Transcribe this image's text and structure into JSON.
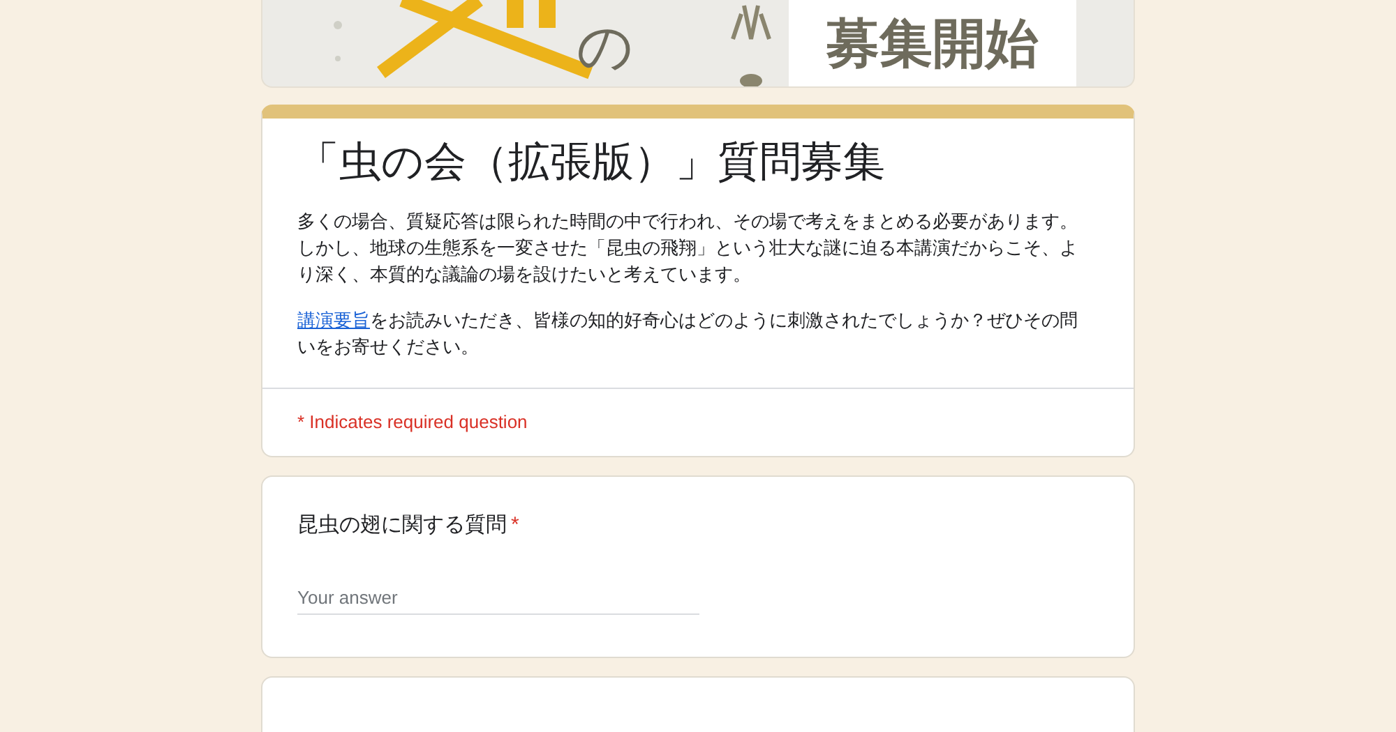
{
  "banner": {
    "texts": [
      "の",
      "募集開始"
    ]
  },
  "form": {
    "title": "「虫の会（拡張版）」質問募集",
    "description": "多くの場合、質疑応答は限られた時間の中で行われ、その場で考えをまとめる必要があります。しかし、地球の生態系を一変させた「昆虫の飛翔」という壮大な謎に迫る本講演だからこそ、より深く、本質的な議論の場を設けたいと考えています。",
    "link": "講演要旨",
    "after_link": "をお読みいただき、皆様の知的好奇心はどのように刺激されたでしょうか？ぜひその問いをお寄せください。",
    "required_note": "* Indicates required question"
  },
  "questions": [
    {
      "label": "昆虫の翅に関する質問",
      "required": true,
      "required_mark": "*",
      "placeholder": "Your answer"
    }
  ]
}
